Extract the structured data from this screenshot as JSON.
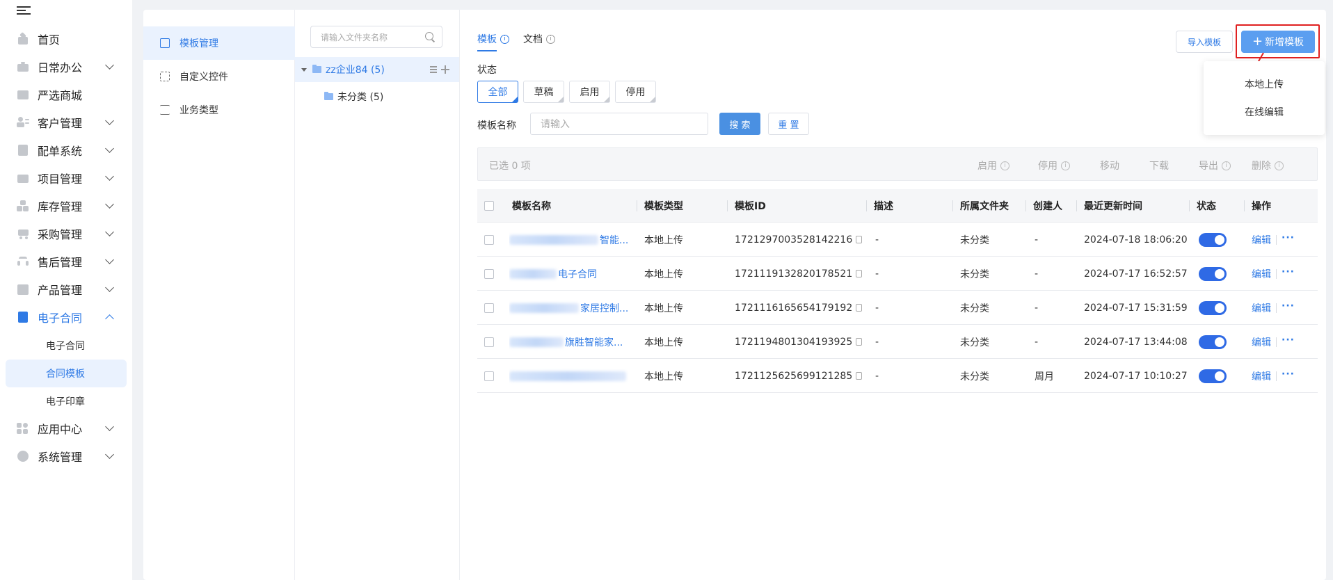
{
  "sidebar": {
    "items": [
      {
        "label": "首页",
        "icon": "home-icon",
        "expandable": false
      },
      {
        "label": "日常办公",
        "icon": "briefcase-icon",
        "expandable": true
      },
      {
        "label": "严选商城",
        "icon": "store-icon",
        "expandable": false
      },
      {
        "label": "客户管理",
        "icon": "customer-icon",
        "expandable": true
      },
      {
        "label": "配单系统",
        "icon": "order-icon",
        "expandable": true
      },
      {
        "label": "项目管理",
        "icon": "folder-icon",
        "expandable": true
      },
      {
        "label": "库存管理",
        "icon": "inventory-icon",
        "expandable": true
      },
      {
        "label": "采购管理",
        "icon": "cart-icon",
        "expandable": true
      },
      {
        "label": "售后管理",
        "icon": "headset-icon",
        "expandable": true
      },
      {
        "label": "产品管理",
        "icon": "product-icon",
        "expandable": true
      },
      {
        "label": "电子合同",
        "icon": "contract-icon",
        "expandable": true,
        "expanded": true
      }
    ],
    "sub_items": [
      "电子合同",
      "合同模板",
      "电子印章"
    ],
    "active_sub": "合同模板",
    "bottom_items": [
      {
        "label": "应用中心",
        "icon": "apps-icon"
      },
      {
        "label": "系统管理",
        "icon": "settings-icon"
      }
    ]
  },
  "content_nav": {
    "items": [
      "模板管理",
      "自定义控件",
      "业务类型"
    ],
    "active": "模板管理"
  },
  "folder_tree": {
    "search_placeholder": "请输入文件夹名称",
    "root": "zz企业84 (5)",
    "children": [
      "未分类 (5)"
    ]
  },
  "main": {
    "tabs": [
      "模板",
      "文档"
    ],
    "active_tab": "模板",
    "import_button": "导入模板",
    "add_button": "新增模板",
    "dropdown": [
      "本地上传",
      "在线编辑"
    ],
    "status_label": "状态",
    "status_filters": [
      "全部",
      "草稿",
      "启用",
      "停用"
    ],
    "active_status": "全部",
    "name_label": "模板名称",
    "name_placeholder": "请输入",
    "search_button": "搜 索",
    "reset_button": "重 置",
    "bulk": {
      "selected_text": "已选  0  项",
      "actions": [
        "启用",
        "停用",
        "移动",
        "下载",
        "导出",
        "删除"
      ]
    }
  },
  "table": {
    "columns": [
      "模板名称",
      "模板类型",
      "模板ID",
      "描述",
      "所属文件夹",
      "创建人",
      "最近更新时间",
      "状态",
      "操作"
    ],
    "rows": [
      {
        "name": "智能...",
        "type": "本地上传",
        "id": "1721297003528142216",
        "desc": "-",
        "folder": "未分类",
        "creator": "-",
        "updated": "2024-07-18 18:06:20",
        "enabled": true
      },
      {
        "name": "电子合同",
        "type": "本地上传",
        "id": "1721119132820178521",
        "desc": "-",
        "folder": "未分类",
        "creator": "-",
        "updated": "2024-07-17 16:52:57",
        "enabled": true
      },
      {
        "name": "家居控制...",
        "type": "本地上传",
        "id": "1721116165654179192",
        "desc": "-",
        "folder": "未分类",
        "creator": "-",
        "updated": "2024-07-17 15:31:59",
        "enabled": true
      },
      {
        "name": "旗胜智能家...",
        "type": "本地上传",
        "id": "1721194801304193925",
        "desc": "-",
        "folder": "未分类",
        "creator": "-",
        "updated": "2024-07-17 13:44:08",
        "enabled": true
      },
      {
        "name": "",
        "type": "本地上传",
        "id": "1721125625699121285",
        "desc": "-",
        "folder": "未分类",
        "creator": "周月",
        "updated": "2024-07-17 10:10:27",
        "enabled": true
      }
    ],
    "edit_label": "编辑",
    "more_label": "···"
  },
  "colors": {
    "accent": "#2f7ae5",
    "highlight": "#e02020"
  }
}
